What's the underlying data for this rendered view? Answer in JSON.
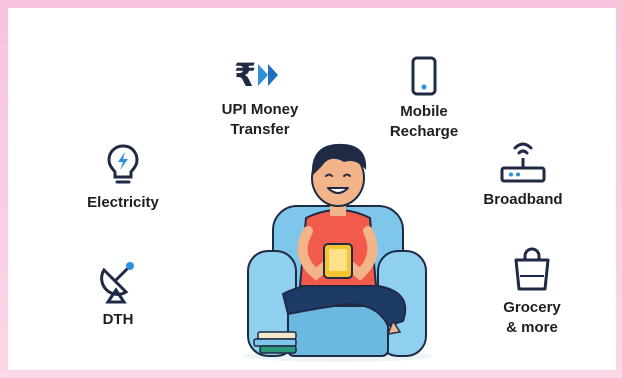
{
  "services": [
    {
      "id": "upi",
      "label": "UPI Money\nTransfer",
      "icon": "rupee-arrow-icon"
    },
    {
      "id": "mobile",
      "label": "Mobile\nRecharge",
      "icon": "mobile-phone-icon"
    },
    {
      "id": "electricity",
      "label": "Electricity",
      "icon": "bulb-icon"
    },
    {
      "id": "broadband",
      "label": "Broadband",
      "icon": "router-icon"
    },
    {
      "id": "dth",
      "label": "DTH",
      "icon": "satellite-dish-icon"
    },
    {
      "id": "grocery",
      "label": "Grocery\n& more",
      "icon": "shopping-bag-icon"
    }
  ],
  "colors": {
    "accent_blue": "#2f8fd8",
    "icon_dark": "#1f2a44",
    "sofa_blue": "#7ec6ea",
    "shirt_red": "#f25b4b",
    "phone_yellow": "#f6c331",
    "pants_navy": "#1e3a67"
  }
}
